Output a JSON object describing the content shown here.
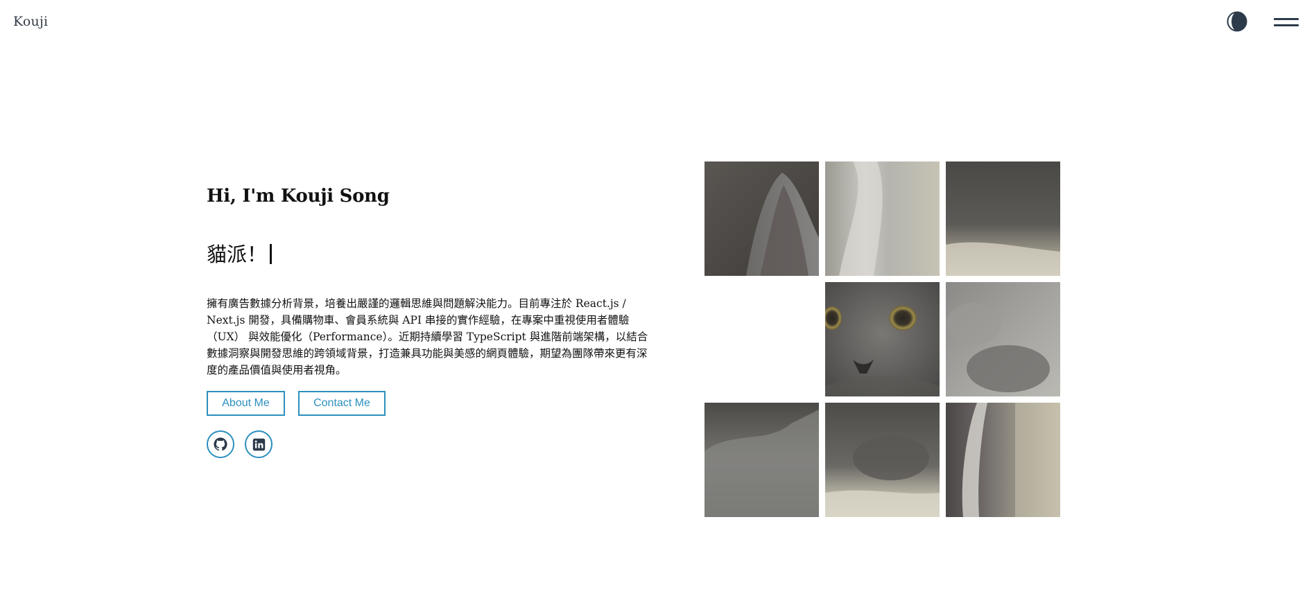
{
  "header": {
    "logo": "Kouji",
    "theme_toggle_icon": "half-moon-contrast-icon",
    "menu_icon": "hamburger-menu-icon"
  },
  "hero": {
    "title": "Hi, I'm Kouji Song",
    "typing_text": "貓派！",
    "intro": "擁有廣告數據分析背景，培養出嚴謹的邏輯思維與問題解決能力。目前專注於 React.js / Next.js 開發，具備購物車、會員系統與 API 串接的實作經驗，在專案中重視使用者體驗（UX） 與效能優化（Performance）。近期持續學習 TypeScript 與進階前端架構，以結合數據洞察與開發思維的跨領域背景，打造兼具功能與美感的網頁體驗，期望為團隊帶來更有深度的產品價值與使用者視角。",
    "buttons": {
      "about": "About Me",
      "contact": "Contact Me"
    },
    "social": {
      "github_icon": "github-icon",
      "linkedin_icon": "linkedin-icon"
    }
  },
  "gallery": {
    "puzzle": "3x3 sliding puzzle of a grey cat photo",
    "empty_slot": 4
  },
  "colors": {
    "accent": "#2b8fbd",
    "text": "#111111",
    "logo": "#333a44",
    "icon": "#2d3a4a",
    "background": "#ffffff"
  }
}
